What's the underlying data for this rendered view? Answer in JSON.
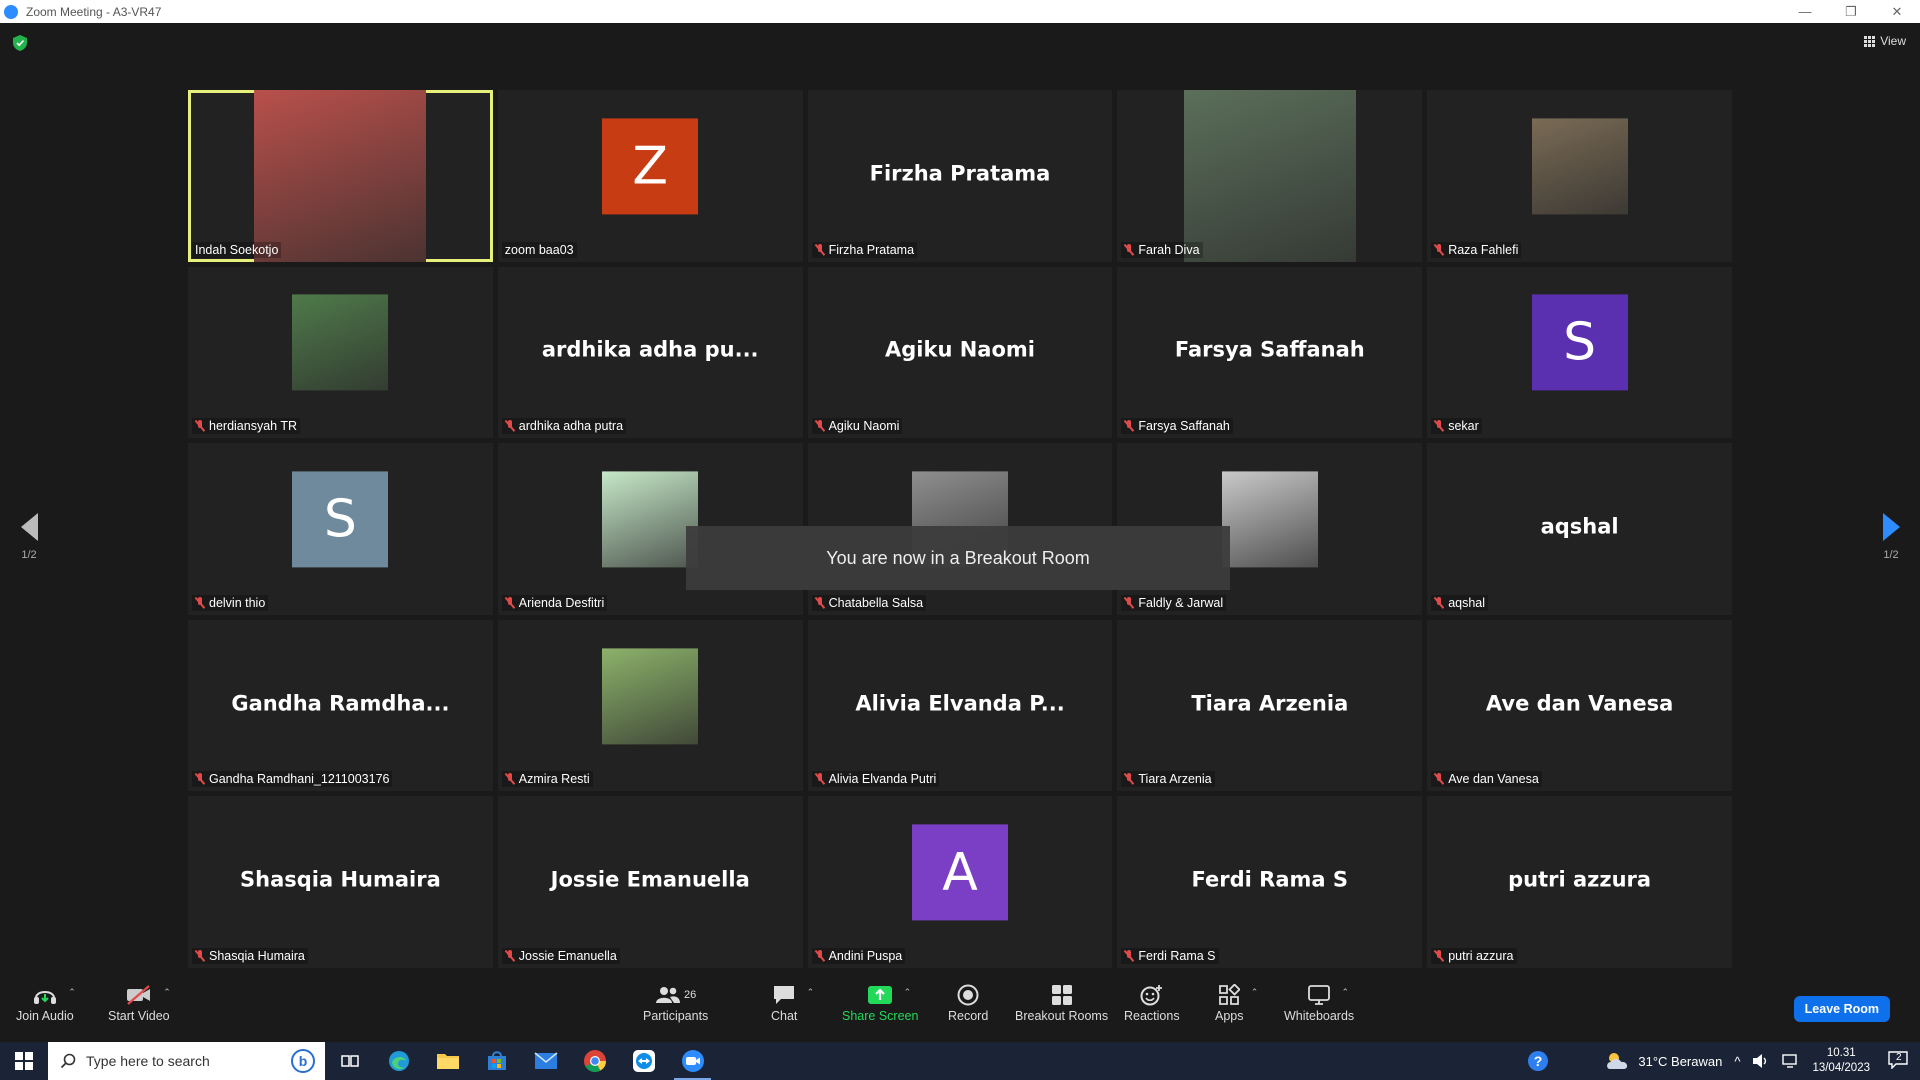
{
  "window": {
    "title": "Zoom Meeting - A3-VR47",
    "minimize": "—",
    "restore": "❐",
    "close": "✕"
  },
  "view_label": "View",
  "toast": "You are now in a Breakout Room",
  "pager": {
    "left": "1/2",
    "right": "1/2"
  },
  "tiles": [
    {
      "label": "Indah Soekotjo",
      "big": "",
      "kind": "photo-large",
      "muted": false,
      "active": true,
      "bg": "#b9504b"
    },
    {
      "label": "zoom baa03",
      "big": "",
      "kind": "letter",
      "letter": "Z",
      "color": "#c83c14",
      "muted": false
    },
    {
      "label": "Firzha Pratama",
      "big": "Firzha Pratama",
      "kind": "name",
      "muted": true
    },
    {
      "label": "Farah Diva",
      "big": "",
      "kind": "photo-large",
      "muted": true,
      "bg": "#5b6f5a"
    },
    {
      "label": "Raza Fahlefi",
      "big": "",
      "kind": "photo",
      "muted": true,
      "bg": "#7a6b55"
    },
    {
      "label": "herdiansyah TR",
      "big": "",
      "kind": "photo",
      "muted": true,
      "bg": "#4f7a4a"
    },
    {
      "label": "ardhika adha putra",
      "big": "ardhika adha pu...",
      "kind": "name",
      "muted": true
    },
    {
      "label": "Agiku Naomi",
      "big": "Agiku Naomi",
      "kind": "name",
      "muted": true
    },
    {
      "label": "Farsya Saffanah",
      "big": "Farsya Saffanah",
      "kind": "name",
      "muted": true
    },
    {
      "label": "sekar",
      "big": "",
      "kind": "letter",
      "letter": "S",
      "color": "#5a2fb0",
      "muted": true
    },
    {
      "label": "delvin thio",
      "big": "",
      "kind": "letter",
      "letter": "S",
      "color": "#6f8a9c",
      "muted": true
    },
    {
      "label": "Arienda Desfitri",
      "big": "",
      "kind": "photo",
      "muted": true,
      "bg": "#c6e8c8"
    },
    {
      "label": "Chatabella Salsa",
      "big": "",
      "kind": "photo",
      "muted": true,
      "bg": "#8f8f8f"
    },
    {
      "label": "Faldly & Jarwal",
      "big": "",
      "kind": "photo",
      "muted": true,
      "bg": "#c9c9c9"
    },
    {
      "label": "aqshal",
      "big": "aqshal",
      "kind": "name",
      "muted": true
    },
    {
      "label": "Gandha Ramdhani_1211003176",
      "big": "Gandha  Ramdha...",
      "kind": "name",
      "muted": true
    },
    {
      "label": "Azmira Resti",
      "big": "",
      "kind": "photo",
      "muted": true,
      "bg": "#8cb26a"
    },
    {
      "label": "Alivia Elvanda Putri",
      "big": "Alivia  Elvanda  P...",
      "kind": "name",
      "muted": true
    },
    {
      "label": "Tiara Arzenia",
      "big": "Tiara Arzenia",
      "kind": "name",
      "muted": true
    },
    {
      "label": "Ave dan Vanesa",
      "big": "Ave dan Vanesa",
      "kind": "name",
      "muted": true
    },
    {
      "label": "Shasqia Humaira",
      "big": "Shasqia Humaira",
      "kind": "name",
      "muted": true
    },
    {
      "label": "Jossie Emanuella",
      "big": "Jossie Emanuella",
      "kind": "name",
      "muted": true
    },
    {
      "label": "Andini Puspa",
      "big": "",
      "kind": "letter",
      "letter": "A",
      "color": "#7a3fc4",
      "muted": true
    },
    {
      "label": "Ferdi Rama S",
      "big": "Ferdi Rama S",
      "kind": "name",
      "muted": true
    },
    {
      "label": "putri azzura",
      "big": "putri azzura",
      "kind": "name",
      "muted": true
    }
  ],
  "toolbar": {
    "join_audio": "Join Audio",
    "start_video": "Start Video",
    "participants": "Participants",
    "participants_count": "26",
    "chat": "Chat",
    "share_screen": "Share Screen",
    "record": "Record",
    "breakout_rooms": "Breakout Rooms",
    "reactions": "Reactions",
    "apps": "Apps",
    "whiteboards": "Whiteboards",
    "leave_room": "Leave Room"
  },
  "taskbar": {
    "search_placeholder": "Type here to search",
    "weather": "31°C  Berawan",
    "time": "10.31",
    "date": "13/04/2023",
    "notifications": "2"
  },
  "colors": {
    "accent": "#0e71eb",
    "active_border": "#e6f07a",
    "muted_mic": "#e14a4a",
    "share_green": "#23d959"
  }
}
